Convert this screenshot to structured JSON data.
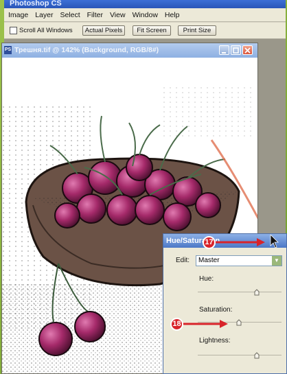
{
  "app": {
    "title": "Photoshop CS"
  },
  "menu": [
    "Image",
    "Layer",
    "Select",
    "Filter",
    "View",
    "Window",
    "Help"
  ],
  "options": {
    "scroll_all_windows": "Scroll All Windows",
    "actual_pixels": "Actual Pixels",
    "fit_screen": "Fit Screen",
    "print_size": "Print Size"
  },
  "document": {
    "title": "Трешня.tif @ 142% (Background, RGB/8#)",
    "icon": "PS"
  },
  "dialog": {
    "title": "Hue/Saturation",
    "edit_label": "Edit:",
    "edit_value": "Master",
    "hue_label": "Hue:",
    "saturation_label": "Saturation:",
    "lightness_label": "Lightness:"
  },
  "callouts": {
    "step17": "17",
    "step18": "18"
  },
  "colors": {
    "frame_green": "#86b23c",
    "callout_red": "#d8232a",
    "dialog_title": "#4c78c7"
  }
}
